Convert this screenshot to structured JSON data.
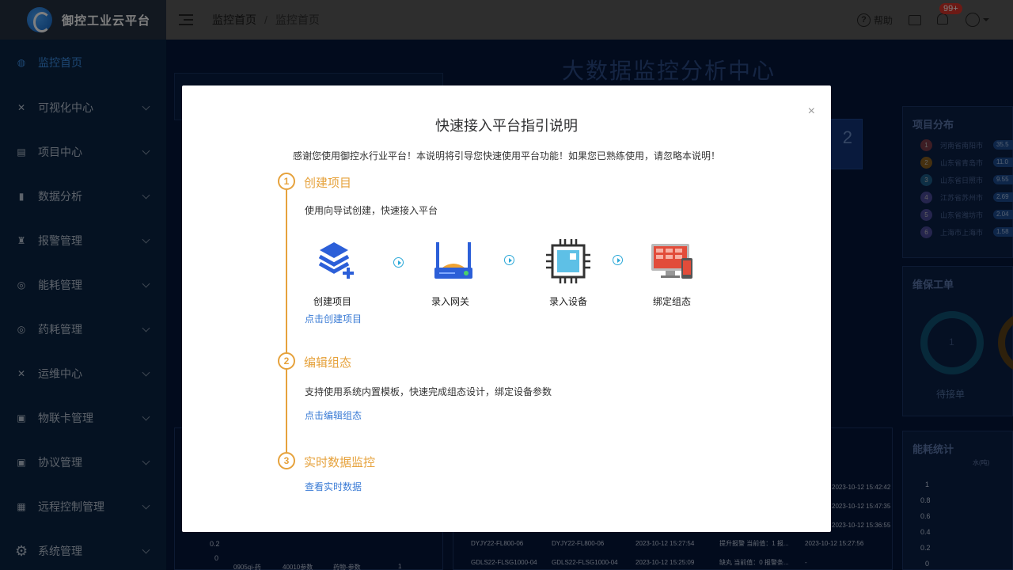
{
  "app": {
    "title": "御控工业云平台"
  },
  "sidebar": {
    "items": [
      {
        "label": "监控首页",
        "icon": "dashboard-icon",
        "active": true
      },
      {
        "label": "可视化中心",
        "icon": "visual-icon"
      },
      {
        "label": "项目中心",
        "icon": "project-icon"
      },
      {
        "label": "数据分析",
        "icon": "chart-icon"
      },
      {
        "label": "报警管理",
        "icon": "alarm-icon"
      },
      {
        "label": "能耗管理",
        "icon": "energy-icon"
      },
      {
        "label": "药耗管理",
        "icon": "medicine-icon"
      },
      {
        "label": "运维中心",
        "icon": "maintenance-icon"
      },
      {
        "label": "物联卡管理",
        "icon": "sim-card-icon"
      },
      {
        "label": "协议管理",
        "icon": "protocol-icon"
      },
      {
        "label": "远程控制管理",
        "icon": "remote-control-icon"
      },
      {
        "label": "系统管理",
        "icon": "gear-icon"
      }
    ]
  },
  "header": {
    "breadcrumb": [
      "监控首页",
      "监控首页"
    ],
    "help_label": "帮助",
    "notification_count": "99+"
  },
  "dashboard": {
    "title": "大数据监控分析中心",
    "number_fragment": "2",
    "project_panel": {
      "title": "项目分布",
      "rows": [
        {
          "num": "1",
          "name": "河南省南阳市",
          "value": "35.5"
        },
        {
          "num": "2",
          "name": "山东省青岛市",
          "value": "11.0"
        },
        {
          "num": "3",
          "name": "山东省日照市",
          "value": "9.55"
        },
        {
          "num": "4",
          "name": "江苏省苏州市",
          "value": "2.69"
        },
        {
          "num": "5",
          "name": "山东省潍坊市",
          "value": "2.04"
        },
        {
          "num": "6",
          "name": "上海市上海市",
          "value": "1.58"
        }
      ]
    },
    "maintenance_panel": {
      "title": "维保工单",
      "ring_value": "1",
      "ring_label": "待接单"
    },
    "energy_panel": {
      "title": "能耗统计",
      "legend": "水(吨)",
      "y_ticks": [
        "1",
        "0.8",
        "0.6",
        "0.4",
        "0.2",
        "0"
      ]
    },
    "left_chart": {
      "y_ticks": [
        "0.2",
        "0"
      ],
      "x_labels": [
        "0905qi-药",
        "40010参数",
        "药物-参数",
        "1"
      ]
    },
    "alarm_times": [
      "2023-10-12 15:42:42",
      "2023-10-12 15:47:35",
      "2023-10-12 15:36:55"
    ],
    "alarm_rows": [
      {
        "device_a": "DYJY22-FL800-06",
        "device_b": "DYJY22-FL800-06",
        "time": "2023-10-12 15:27:54",
        "desc": "提升报警 当前值：1 报...",
        "time2": "2023-10-12 15:27:56"
      },
      {
        "device_a": "GDLS22-FLSG1000-04",
        "device_b": "GDLS22-FLSG1000-04",
        "time": "2023-10-12 15:25:09",
        "desc": "缺丸 当前值：0 报警条...",
        "time2": "-"
      }
    ]
  },
  "modal": {
    "title": "快速接入平台指引说明",
    "intro": "感谢您使用御控水行业平台！本说明将引导您快速使用平台功能！如果您已熟练使用，请忽略本说明！",
    "steps": [
      {
        "num": "1",
        "title": "创建项目",
        "desc": "使用向导试创建，快速接入平台",
        "link": "点击创建项目",
        "flow": [
          {
            "label": "创建项目",
            "icon": "layers-plus-icon"
          },
          {
            "label": "录入网关",
            "icon": "router-icon"
          },
          {
            "label": "录入设备",
            "icon": "chip-icon"
          },
          {
            "label": "绑定组态",
            "icon": "monitor-icon"
          }
        ]
      },
      {
        "num": "2",
        "title": "编辑组态",
        "desc": "支持使用系统内置模板，快速完成组态设计，绑定设备参数",
        "link": "点击编辑组态"
      },
      {
        "num": "3",
        "title": "实时数据监控",
        "link": "查看实时数据"
      }
    ],
    "close_label": "×"
  },
  "colors": {
    "accent": "#e6a23c",
    "link": "#3a7bd5",
    "sidebar_bg": "#0b2545",
    "active": "#3a8ee6"
  }
}
